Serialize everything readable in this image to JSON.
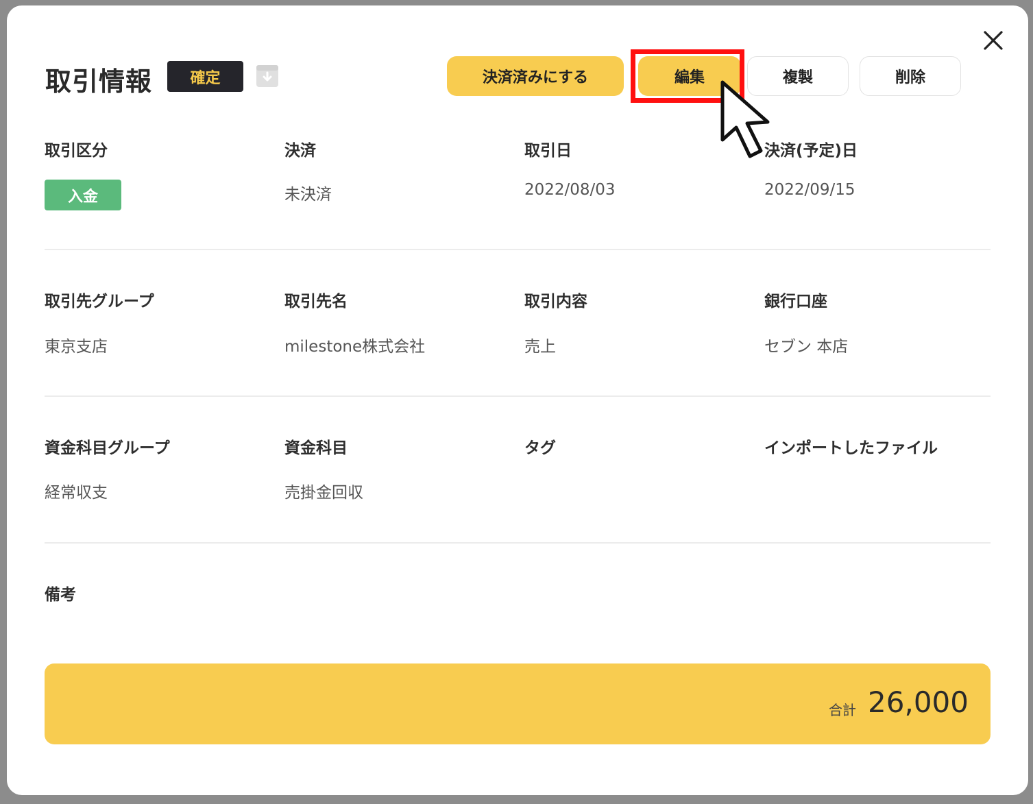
{
  "modal": {
    "title": "取引情報",
    "status_badge": "確定"
  },
  "actions": {
    "settle": "決済済みにする",
    "edit": "編集",
    "duplicate": "複製",
    "delete": "削除"
  },
  "row1": {
    "type_label": "取引区分",
    "type_value": "入金",
    "settlement_label": "決済",
    "settlement_value": "未決済",
    "date_label": "取引日",
    "date_value": "2022/08/03",
    "due_label": "決済(予定)日",
    "due_value": "2022/09/15"
  },
  "row2": {
    "partner_group_label": "取引先グループ",
    "partner_group_value": "東京支店",
    "partner_label": "取引先名",
    "partner_value": "milestone株式会社",
    "content_label": "取引内容",
    "content_value": "売上",
    "bank_label": "銀行口座",
    "bank_value": "セブン 本店"
  },
  "row3": {
    "fund_group_label": "資金科目グループ",
    "fund_group_value": "経常収支",
    "fund_label": "資金科目",
    "fund_value": "売掛金回収",
    "tag_label": "タグ",
    "tag_value": "",
    "import_label": "インポートしたファイル",
    "import_value": ""
  },
  "notes": {
    "label": "備考",
    "value": ""
  },
  "total": {
    "label": "合計",
    "value": "26,000"
  },
  "colors": {
    "accent_yellow": "#f8cc50",
    "badge_dark": "#25252b",
    "deposit_green": "#5bba7c",
    "highlight_red": "#ff1010"
  },
  "icons": {
    "close": "close-icon",
    "archive": "archive-download-icon",
    "cursor": "mouse-pointer-icon"
  }
}
